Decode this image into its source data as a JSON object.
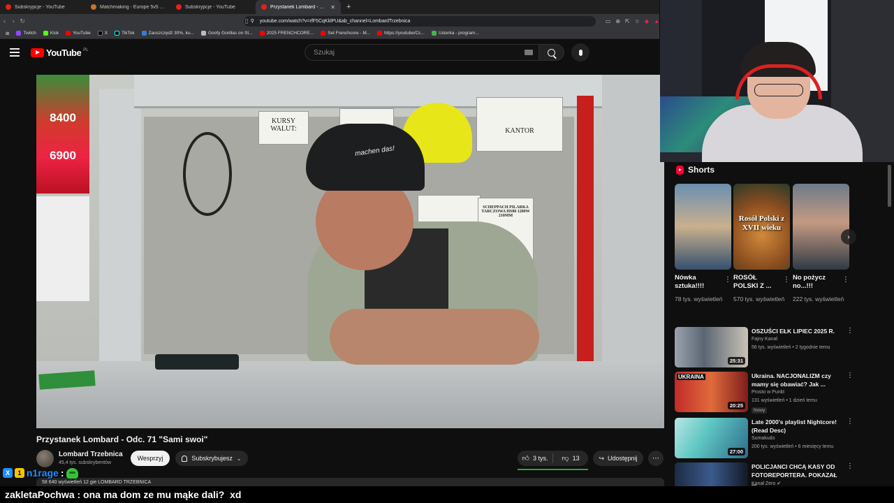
{
  "browser": {
    "tabs": [
      {
        "title": "Subskrypcje - YouTube",
        "active": false
      },
      {
        "title": "Matchmaking - Europe 5v5 Queue -",
        "active": false
      },
      {
        "title": "Subskrypcje - YouTube",
        "active": false
      },
      {
        "title": "Przystanek Lombard - Odc. 7",
        "active": true
      }
    ],
    "url": "youtube.com/watch?v=rfF5CqKklPU&ab_channel=LombardTrzebnica",
    "bookmarks": [
      "Twitch",
      "Kick",
      "YouTube",
      "X",
      "TikTok",
      "Zaoszczędź 30%, ku...",
      "Goofy Gorillas on St...",
      "2025 FRENCHCORE...",
      "Set Frenchcore - M...",
      "https://youtube/Cc...",
      "Usterka - program..."
    ]
  },
  "youtube": {
    "logo_text": "YouTube",
    "region": "PL",
    "search_placeholder": "Szukaj"
  },
  "video": {
    "title": "Przystanek Lombard - Odc. 71 \"Sami swoi\"",
    "channel": "Lombard Trzebnica",
    "subscribers": "45,4 tys. subskrybentów",
    "support_label": "Wesprzyj",
    "subscribe_label": "Subskrybujesz",
    "likes": "3 tys.",
    "dislikes": "13",
    "share_label": "Udostępnij",
    "description_preview": "58 640 wyświetleń  12 gie  LOMBARD TRZEBNICA",
    "scene_signs": {
      "kursy": "KURSY WALUT:",
      "kantor": "KANTOR",
      "cap_text": "machen das!",
      "poster_price_1": "8400",
      "poster_price_2": "6900",
      "pilarka": "SCHEPPACH PILARKA TARCZOWA HS80 1200W 210MM"
    }
  },
  "sidebar": {
    "shorts_title": "Shorts",
    "shorts": [
      {
        "title": "Nówka sztuka!!!!",
        "views": "78 tys. wyświetleń"
      },
      {
        "title": "ROSÓŁ POLSKI Z ...",
        "views": "570 tys. wyświetleń",
        "overlay": "Rosół Polski z XVII wieku"
      },
      {
        "title": "No pożycz no...!!!",
        "views": "222 tys. wyświetleń"
      }
    ],
    "recommended": [
      {
        "title": "OSZUŚCI EŁK LIPIEC 2025 R.",
        "channel": "Fajny Kanał",
        "meta": "56 tys. wyświetleń • 2 tygodnie temu",
        "duration": "25:31",
        "badge": ""
      },
      {
        "title": "Ukraina. NACJONALIZM czy mamy się obawiać? Jak ...",
        "channel": "Prosto w Punkt",
        "meta": "131 wyświetleń • 1 dzień temu",
        "duration": "20:25",
        "badge": "Nowy",
        "thumb_text": "UKRAINA"
      },
      {
        "title": "Late 2000's playlist Nightcore! (Read Desc)",
        "channel": "Sumakudo",
        "meta": "200 tys. wyświetleń • 6 miesięcy temu",
        "duration": "27:00",
        "badge": ""
      },
      {
        "title": "POLICJANCI CHCĄ KASY OD FOTOREPORTERA. POKAZAŁ ...",
        "channel": "Kanał Zero",
        "meta": "",
        "duration": "",
        "badge": ""
      }
    ]
  },
  "chat": {
    "line1_user": "n1rage",
    "line1_badge_a": "X",
    "line1_badge_b": "1",
    "line2_user": "zakletaPochwa",
    "line2_message": " : ona ma dom ze mu mąke dali?  xd"
  },
  "colors": {
    "background": "#0f0f0f",
    "yt_red": "#ff0000",
    "like_underline": "#2ba640",
    "chat_user1": "#1e90ff"
  }
}
